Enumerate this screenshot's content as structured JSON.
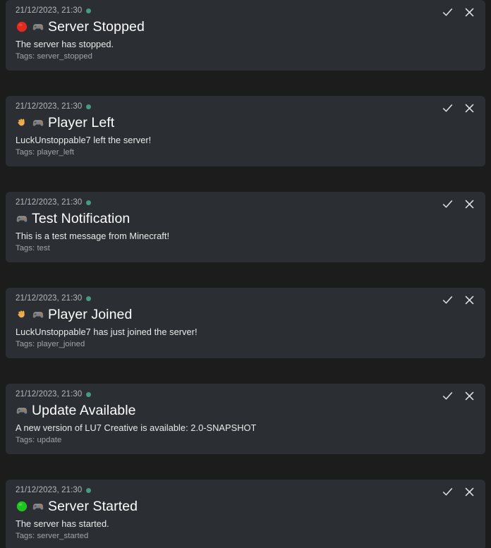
{
  "app": {
    "view_name": "Notification Feed",
    "theme": "dark",
    "background_color": "#1c1c1c",
    "card_color": "#2b2f33",
    "accent_color": "#3f9e7d",
    "title_color": "#ffffff",
    "body_color": "#ebebeb",
    "muted_color": "#a2a5a7"
  },
  "actions": {
    "mark_read_label": "check-mark",
    "dismiss_label": "close-cross"
  },
  "notifications": [
    {
      "timestamp": "21/12/2023, 21:30",
      "status": "unread",
      "emoji": [
        "red-circle",
        "video-game-controller"
      ],
      "title": "Server Stopped",
      "body": "The server has stopped.",
      "tags": "Tags: server_stopped"
    },
    {
      "timestamp": "21/12/2023, 21:30",
      "status": "unread",
      "emoji": [
        "waving-hand",
        "video-game-controller"
      ],
      "title": "Player Left",
      "body": "LuckUnstoppable7 left the server!",
      "tags": "Tags: player_left"
    },
    {
      "timestamp": "21/12/2023, 21:30",
      "status": "unread",
      "emoji": [
        "video-game-controller"
      ],
      "title": "Test Notification",
      "body": "This is a test message from Minecraft!",
      "tags": "Tags: test"
    },
    {
      "timestamp": "21/12/2023, 21:30",
      "status": "unread",
      "emoji": [
        "waving-hand",
        "video-game-controller"
      ],
      "title": "Player Joined",
      "body": "LuckUnstoppable7 has just joined the server!",
      "tags": "Tags: player_joined"
    },
    {
      "timestamp": "21/12/2023, 21:30",
      "status": "unread",
      "emoji": [
        "video-game-controller"
      ],
      "title": "Update Available",
      "body": "A new version of LU7 Creative is available: 2.0-SNAPSHOT",
      "tags": "Tags: update"
    },
    {
      "timestamp": "21/12/2023, 21:30",
      "status": "unread",
      "emoji": [
        "green-circle",
        "video-game-controller"
      ],
      "title": "Server Started",
      "body": "The server has started.",
      "tags": "Tags: server_started"
    }
  ]
}
